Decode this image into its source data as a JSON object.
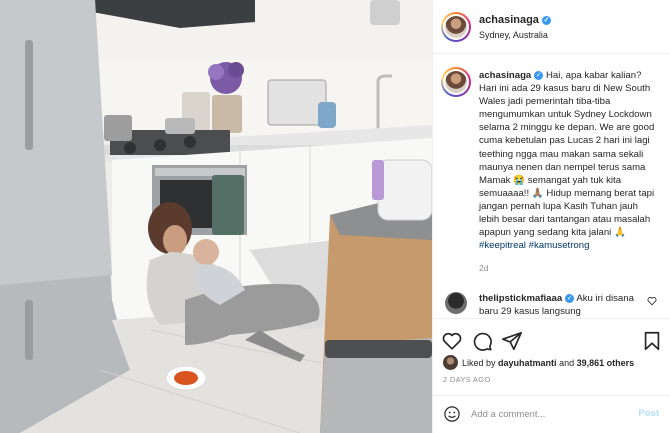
{
  "post": {
    "username": "achasinaga",
    "location": "Sydney, Australia",
    "verified_mark": "✓",
    "caption_user": "achasinaga",
    "caption_text": "Hai, apa kabar kalian? Hari ini ada 29 kasus baru di New South Wales jadi pemerintah tiba-tiba mengumumkan untuk Sydney Lockdown selama 2 minggu ke depan. We are good cuma kebetulan pas Lucas 2 hari ini lagi teething ngga mau makan sama sekali maunya nenen dan nempel terus sama Mamak 😭 semangat yah tuk kita semuaaaa!! 🙏🏽 Hidup memang berat tapi jangan pernah lupa Kasih Tuhan jauh lebih besar dari tantangan atau masalah apapun yang sedang kita jalani 🙏",
    "hashtags": [
      "#keepitreal",
      "#kamusetrong"
    ],
    "time_ago": "2d"
  },
  "comments": [
    {
      "username": "thelipstickmafiaaa",
      "text": "Aku iri disana baru 29 kasus langsung"
    }
  ],
  "engagement": {
    "liked_by_prefix": "Liked by",
    "liked_by_user": "dayuhatmanti",
    "and_text": "and",
    "others_count": "39,861 others",
    "posted": "2 DAYS AGO"
  },
  "composer": {
    "placeholder": "Add a comment...",
    "post_label": "Post"
  },
  "icons": {
    "like": "heart-icon",
    "comment": "comment-icon",
    "share": "share-icon",
    "save": "bookmark-icon",
    "emoji": "emoji-icon",
    "comment_like": "heart-icon"
  },
  "colors": {
    "link": "#00376b",
    "verified": "#3897f0",
    "muted": "#8e8e8e",
    "post_disabled": "#b2dffc"
  }
}
